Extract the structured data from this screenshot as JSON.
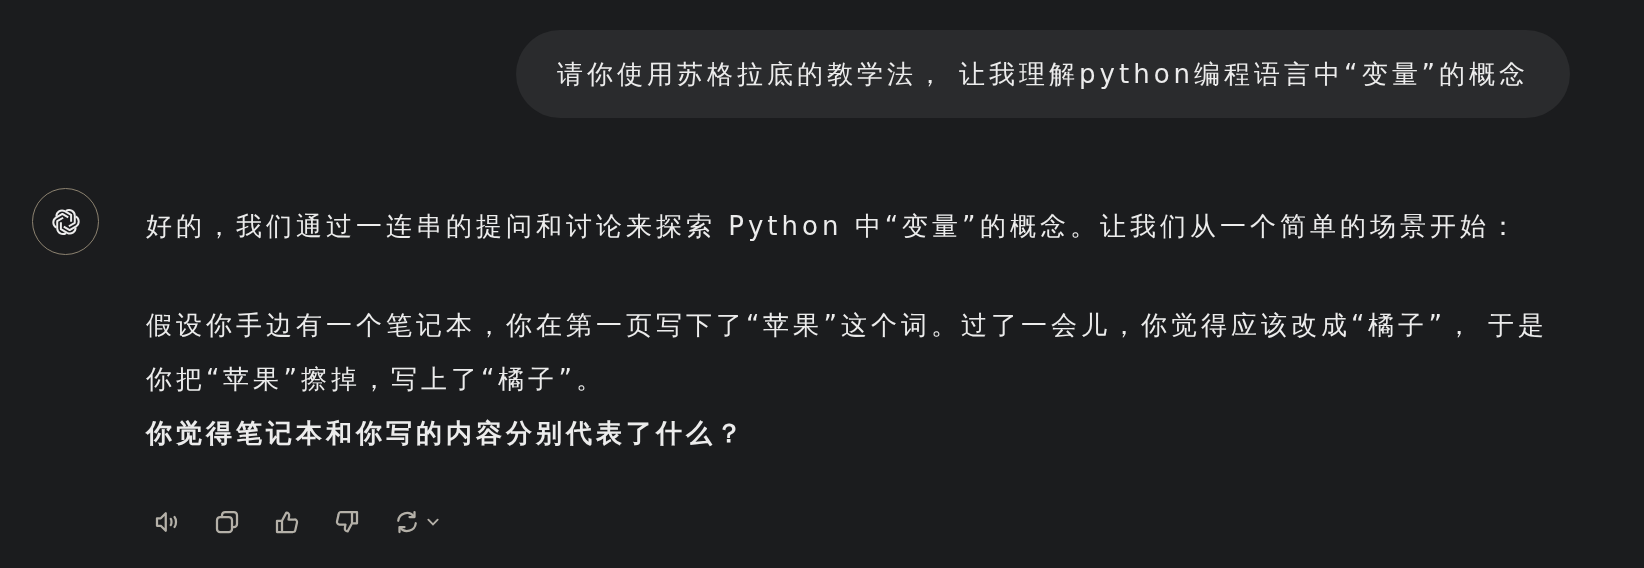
{
  "user_message": {
    "text": "请你使用苏格拉底的教学法， 让我理解python编程语言中“变量”的概念"
  },
  "assistant_message": {
    "paragraphs": [
      {
        "sentences": [
          {
            "text": "好的，我们通过一连串的提问和讨论来探索 Python 中“变量”的概念。让我们从一个简单的场景开始：",
            "bold": false
          }
        ]
      },
      {
        "sentences": [
          {
            "text": "假设你手边有一个笔记本，你在第一页写下了“苹果”这个词。过了一会儿，你觉得应该改成“橘子”， 于是你把“苹果”擦掉，写上了“橘子”。",
            "bold": false
          },
          {
            "text": "你觉得笔记本和你写的内容分别代表了什么？",
            "bold": true
          }
        ]
      }
    ],
    "actions": [
      {
        "kind": "read-aloud"
      },
      {
        "kind": "copy"
      },
      {
        "kind": "thumbs-up"
      },
      {
        "kind": "thumbs-down"
      },
      {
        "kind": "regenerate"
      }
    ]
  }
}
